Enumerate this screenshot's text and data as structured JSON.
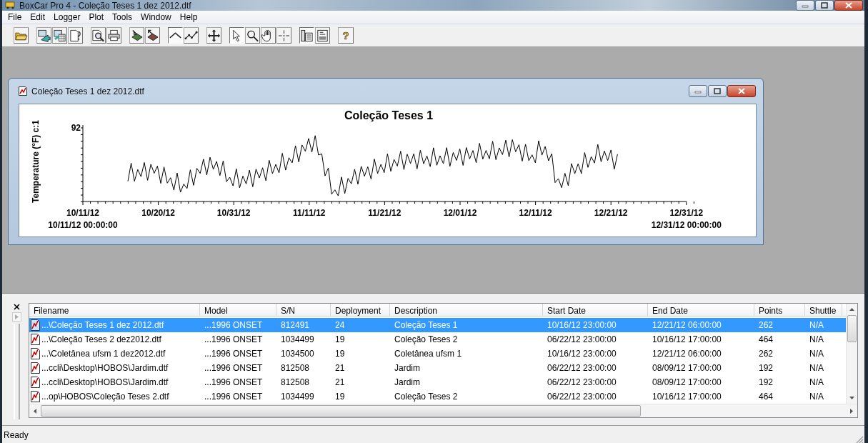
{
  "window": {
    "title": "BoxCar Pro 4 - Coleção Teses 1 dez 2012.dtf"
  },
  "menu": [
    "File",
    "Edit",
    "Logger",
    "Plot",
    "Tools",
    "Window",
    "Help"
  ],
  "toolbar": {
    "groups": [
      {
        "buttons": [
          {
            "pressed": false
          }
        ]
      },
      {
        "buttons": [
          {
            "pressed": false
          },
          {
            "pressed": false
          },
          {
            "pressed": false
          }
        ]
      },
      {
        "buttons": [
          {
            "pressed": false
          },
          {
            "pressed": false
          }
        ]
      },
      {
        "buttons": [
          {
            "pressed": false
          },
          {
            "pressed": false
          }
        ]
      },
      {
        "buttons": [
          {
            "pressed": true
          },
          {
            "pressed": false
          }
        ]
      },
      {
        "buttons": [
          {
            "pressed": false
          }
        ]
      },
      {
        "buttons": [
          {
            "pressed": true
          },
          {
            "pressed": false
          },
          {
            "pressed": false
          },
          {
            "pressed": false
          }
        ]
      },
      {
        "buttons": [
          {
            "pressed": true
          },
          {
            "pressed": false
          }
        ]
      },
      {
        "buttons": [
          {
            "pressed": false,
            "glyph": "?"
          }
        ]
      }
    ]
  },
  "plot_window": {
    "title": "Coleção Teses 1 dez 2012.dtf",
    "plot": {
      "title": "Coleção Teses 1",
      "ylabel": "Temperature (°F) c:1",
      "y_top_label": "92",
      "x_tick_labels": [
        "10/11/12",
        "10/20/12",
        "10/31/12",
        "11/11/12",
        "11/21/12",
        "12/01/12",
        "12/11/12",
        "12/21/12",
        "12/31/12"
      ],
      "start_label": "10/11/12 00:00:00",
      "end_label": "12/31/12 00:00:00"
    }
  },
  "file_list": {
    "columns": [
      "Filename",
      "Model",
      "S/N",
      "Deployment",
      "Description",
      "Start Date",
      "End Date",
      "Points",
      "Shuttle"
    ],
    "rows": [
      {
        "selected": true,
        "cells": [
          "...\\Coleção Teses 1 dez 2012.dtf",
          "...1996 ONSET",
          "812491",
          "24",
          "Coleção Teses 1",
          "10/16/12 23:00:00",
          "12/21/12 06:00:00",
          "262",
          "N/A"
        ]
      },
      {
        "selected": false,
        "cells": [
          "...\\Coleção Teses 2 dez2012.dtf",
          "...1996 ONSET",
          "1034499",
          "19",
          "Coleção Teses 2",
          "06/22/12 23:00:00",
          "10/16/12 17:00:00",
          "464",
          "N/A"
        ]
      },
      {
        "selected": false,
        "cells": [
          "...\\Coletânea ufsm 1 dez2012.dtf",
          "...1996 ONSET",
          "1034500",
          "19",
          "Coletânea ufsm 1",
          "10/16/12 23:00:00",
          "12/21/12 06:00:00",
          "262",
          "N/A"
        ]
      },
      {
        "selected": false,
        "cells": [
          "...ccli\\Desktop\\HOBOS\\Jardim.dtf",
          "...1996 ONSET",
          "812508",
          "21",
          "Jardim",
          "06/22/12 23:00:00",
          "08/09/12 17:00:00",
          "192",
          "N/A"
        ]
      },
      {
        "selected": false,
        "cells": [
          "...ccli\\Desktop\\HOBOS\\Jardim.dtf",
          "...1996 ONSET",
          "812508",
          "21",
          "Jardim",
          "06/22/12 23:00:00",
          "08/09/12 17:00:00",
          "192",
          "N/A"
        ]
      },
      {
        "selected": false,
        "cells": [
          "...op\\HOBOS\\Coleção Teses 2.dtf",
          "...1996 ONSET",
          "1034499",
          "19",
          "Coleção Teses 2",
          "06/22/12 23:00:00",
          "10/16/12 17:00:00",
          "464",
          "N/A"
        ]
      }
    ]
  },
  "status_bar": "Ready"
}
